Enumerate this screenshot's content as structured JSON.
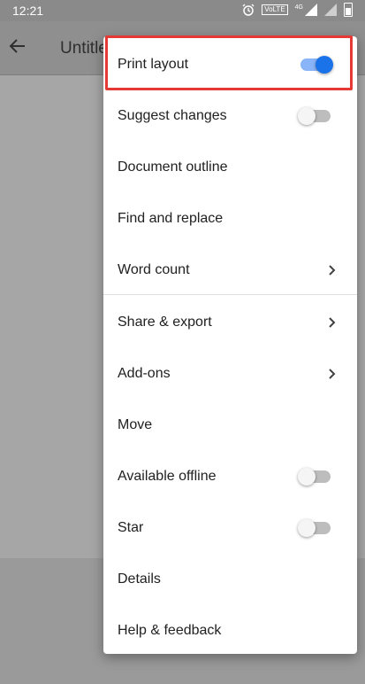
{
  "status_bar": {
    "time": "12:21",
    "volte_label": "VoLTE",
    "network": "4G",
    "icons": [
      "alarm-icon",
      "volte-icon",
      "signal-icon",
      "signal-icon",
      "battery-icon"
    ]
  },
  "app_bar": {
    "title": "Untitled"
  },
  "menu": {
    "items": [
      {
        "label": "Print layout",
        "control": "toggle",
        "state": "on"
      },
      {
        "label": "Suggest changes",
        "control": "toggle",
        "state": "off"
      },
      {
        "label": "Document outline"
      },
      {
        "label": "Find and replace"
      },
      {
        "label": "Word count",
        "control": "chevron"
      },
      {
        "label": "Share & export",
        "control": "chevron"
      },
      {
        "label": "Add-ons",
        "control": "chevron"
      },
      {
        "label": "Move"
      },
      {
        "label": "Available offline",
        "control": "toggle",
        "state": "off"
      },
      {
        "label": "Star",
        "control": "toggle",
        "state": "off"
      },
      {
        "label": "Details"
      },
      {
        "label": "Help & feedback"
      }
    ]
  },
  "colors": {
    "toggle_on": "#1a73e8",
    "highlight": "#e53935"
  }
}
